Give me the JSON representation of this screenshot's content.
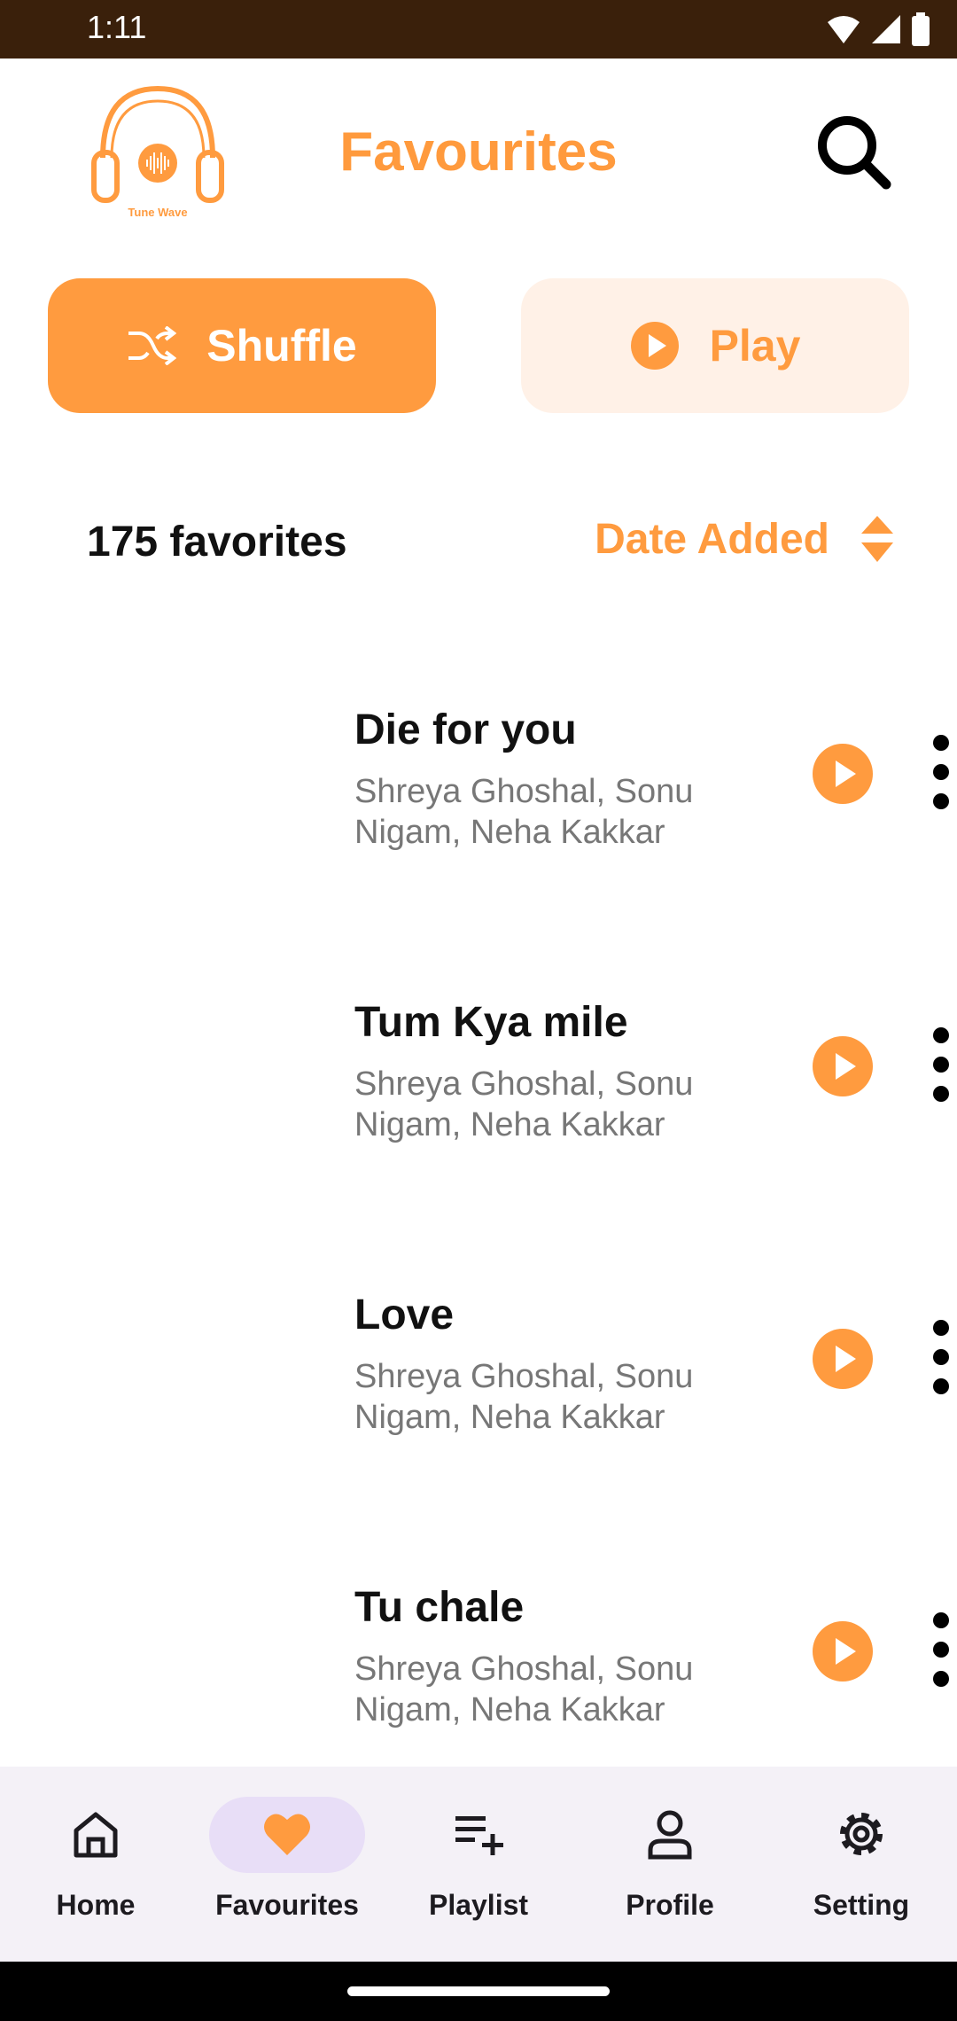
{
  "status_bar": {
    "time": "1:11"
  },
  "header": {
    "title": "Favourites",
    "logo_text": "Tune Wave"
  },
  "actions": {
    "shuffle_label": "Shuffle",
    "play_label": "Play"
  },
  "list_header": {
    "count_label": "175 favorites",
    "sort_label": "Date Added"
  },
  "songs": [
    {
      "title": "Die for you",
      "artist": "Shreya Ghoshal, Sonu Nigam, Neha Kakkar"
    },
    {
      "title": "Tum Kya mile",
      "artist": "Shreya Ghoshal, Sonu Nigam, Neha Kakkar"
    },
    {
      "title": "Love",
      "artist": "Shreya Ghoshal, Sonu Nigam, Neha Kakkar"
    },
    {
      "title": "Tu chale",
      "artist": "Shreya Ghoshal, Sonu Nigam, Neha Kakkar"
    }
  ],
  "nav": [
    {
      "label": "Home",
      "icon": "home-icon"
    },
    {
      "label": "Favourites",
      "icon": "heart-icon",
      "active": true
    },
    {
      "label": "Playlist",
      "icon": "playlist-add-icon"
    },
    {
      "label": "Profile",
      "icon": "person-icon"
    },
    {
      "label": "Setting",
      "icon": "gear-icon"
    }
  ],
  "colors": {
    "accent": "#ff9b3f",
    "accent_light": "#fff1e7",
    "status_bar": "#3a200b",
    "nav_bg": "#f4f1f7",
    "nav_active": "#e8def7"
  }
}
